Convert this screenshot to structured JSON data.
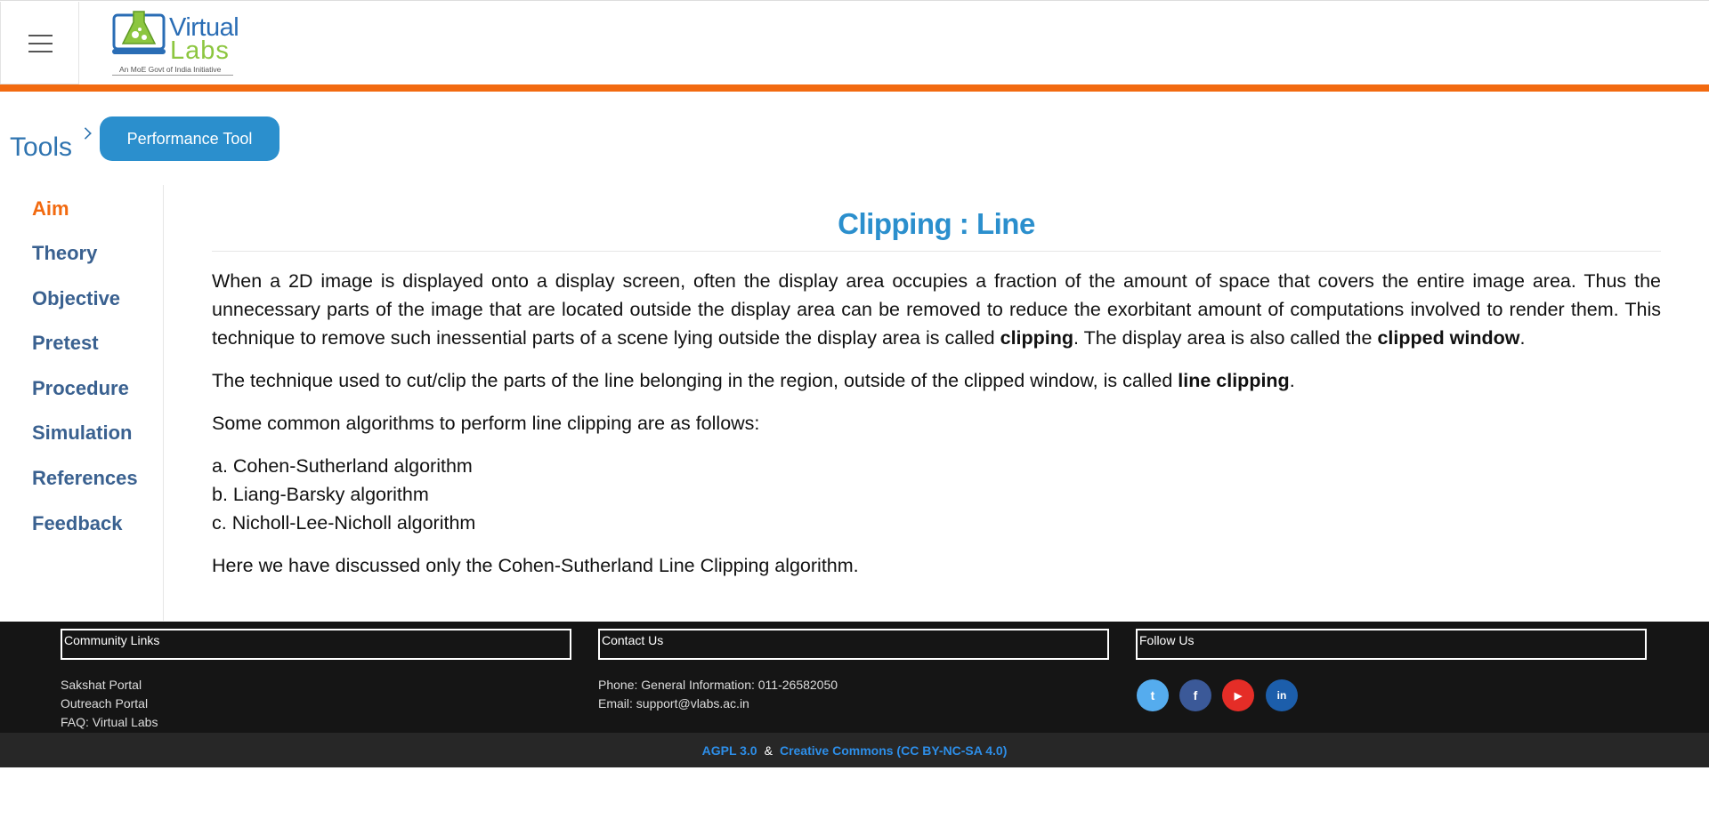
{
  "header": {
    "menu_icon": "hamburger-icon",
    "logo": {
      "word1": "Virtual",
      "word2": "Labs",
      "tagline": "An MoE Govt of India Initiative",
      "colors": {
        "blue": "#2a6db5",
        "green": "#8cc63f"
      }
    },
    "accent_color": "#f26a10"
  },
  "breadcrumb": {
    "root": "Tools",
    "separator_icon": "chevron-right-icon",
    "current": "Performance Tool"
  },
  "sidebar": {
    "items": [
      {
        "label": "Aim",
        "active": true
      },
      {
        "label": "Theory",
        "active": false
      },
      {
        "label": "Objective",
        "active": false
      },
      {
        "label": "Pretest",
        "active": false
      },
      {
        "label": "Procedure",
        "active": false
      },
      {
        "label": "Simulation",
        "active": false
      },
      {
        "label": "References",
        "active": false
      },
      {
        "label": "Feedback",
        "active": false
      }
    ]
  },
  "main": {
    "title": "Clipping : Line",
    "p1_a": "When a 2D image is displayed onto a display screen, often the display area occupies a fraction of the amount of space that covers the entire image area. Thus the unnecessary parts of the image that are located outside the display area can be removed to reduce the exorbitant amount of computations involved to render them. This technique to remove such inessential parts of a scene lying outside the display area is called ",
    "p1_b": "clipping",
    "p1_c": ". The display area is also called the ",
    "p1_d": "clipped window",
    "p1_e": ".",
    "p2_a": "The technique used to cut/clip the parts of the line belonging in the region, outside of the clipped window, is called ",
    "p2_b": "line clipping",
    "p2_c": ".",
    "p3": "Some common algorithms to perform line clipping are as follows:",
    "algorithms": [
      "a. Cohen-Sutherland algorithm",
      "b. Liang-Barsky algorithm",
      "c. Nicholl-Lee-Nicholl algorithm"
    ],
    "p4": "Here we have discussed only the Cohen-Sutherland Line Clipping algorithm."
  },
  "footer": {
    "community": {
      "heading": "Community Links",
      "links": [
        "Sakshat Portal",
        "Outreach Portal",
        "FAQ: Virtual Labs"
      ]
    },
    "contact": {
      "heading": "Contact Us",
      "phone": "Phone: General Information: 011-26582050",
      "email": "Email: support@vlabs.ac.in"
    },
    "follow": {
      "heading": "Follow Us",
      "social": [
        {
          "icon": "twitter-icon",
          "glyph": "t",
          "color": "#55acee"
        },
        {
          "icon": "facebook-icon",
          "glyph": "f",
          "color": "#3b5998"
        },
        {
          "icon": "youtube-icon",
          "glyph": "▶",
          "color": "#e52d27"
        },
        {
          "icon": "linkedin-icon",
          "glyph": "in",
          "color": "#1c5eab"
        }
      ]
    },
    "license": {
      "agpl": "AGPL 3.0",
      "amp": "&",
      "cc": "Creative Commons (CC BY-NC-SA 4.0)"
    }
  }
}
